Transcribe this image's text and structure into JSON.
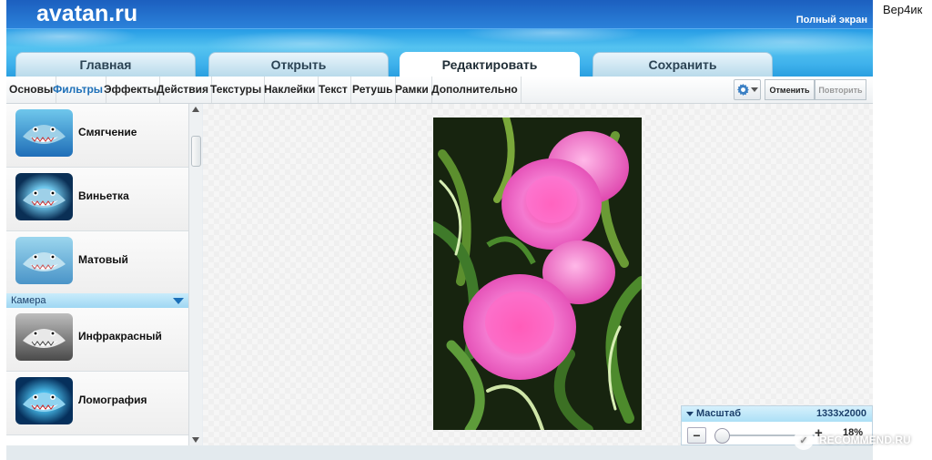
{
  "header": {
    "logo": "avatan.ru",
    "fullscreen": "Полный экран"
  },
  "tabs": [
    {
      "label": "Главная",
      "active": false
    },
    {
      "label": "Открыть",
      "active": false
    },
    {
      "label": "Редактировать",
      "active": true
    },
    {
      "label": "Сохранить",
      "active": false
    }
  ],
  "toolbar": {
    "items": [
      "Основы",
      "Фильтры",
      "Эффекты",
      "Действия",
      "Текстуры",
      "Наклейки",
      "Текст",
      "Ретушь",
      "Рамки",
      "Дополнительно"
    ],
    "active_item": "Фильтры",
    "undo": "Отменить",
    "redo": "Повторить",
    "settings_icon": "gear-icon"
  },
  "filters": {
    "group1": [
      {
        "label": "Смягчение",
        "thumb_color": "blue"
      },
      {
        "label": "Виньетка",
        "thumb_color": "blue"
      },
      {
        "label": "Матовый",
        "thumb_color": "blue"
      }
    ],
    "category": "Камера",
    "group2": [
      {
        "label": "Инфракрасный",
        "thumb_color": "gray"
      },
      {
        "label": "Ломография",
        "thumb_color": "blue"
      }
    ]
  },
  "zoom": {
    "title": "Масштаб",
    "size": "1333x2000",
    "percent": "18%",
    "minus": "−",
    "plus": "+"
  },
  "side_label": "Вер4ик",
  "watermark": "RECOMMEND.RU",
  "colors": {
    "header_dark": "#1c5fbf",
    "header_light": "#55c3f0",
    "accent": "#1e70b8"
  }
}
